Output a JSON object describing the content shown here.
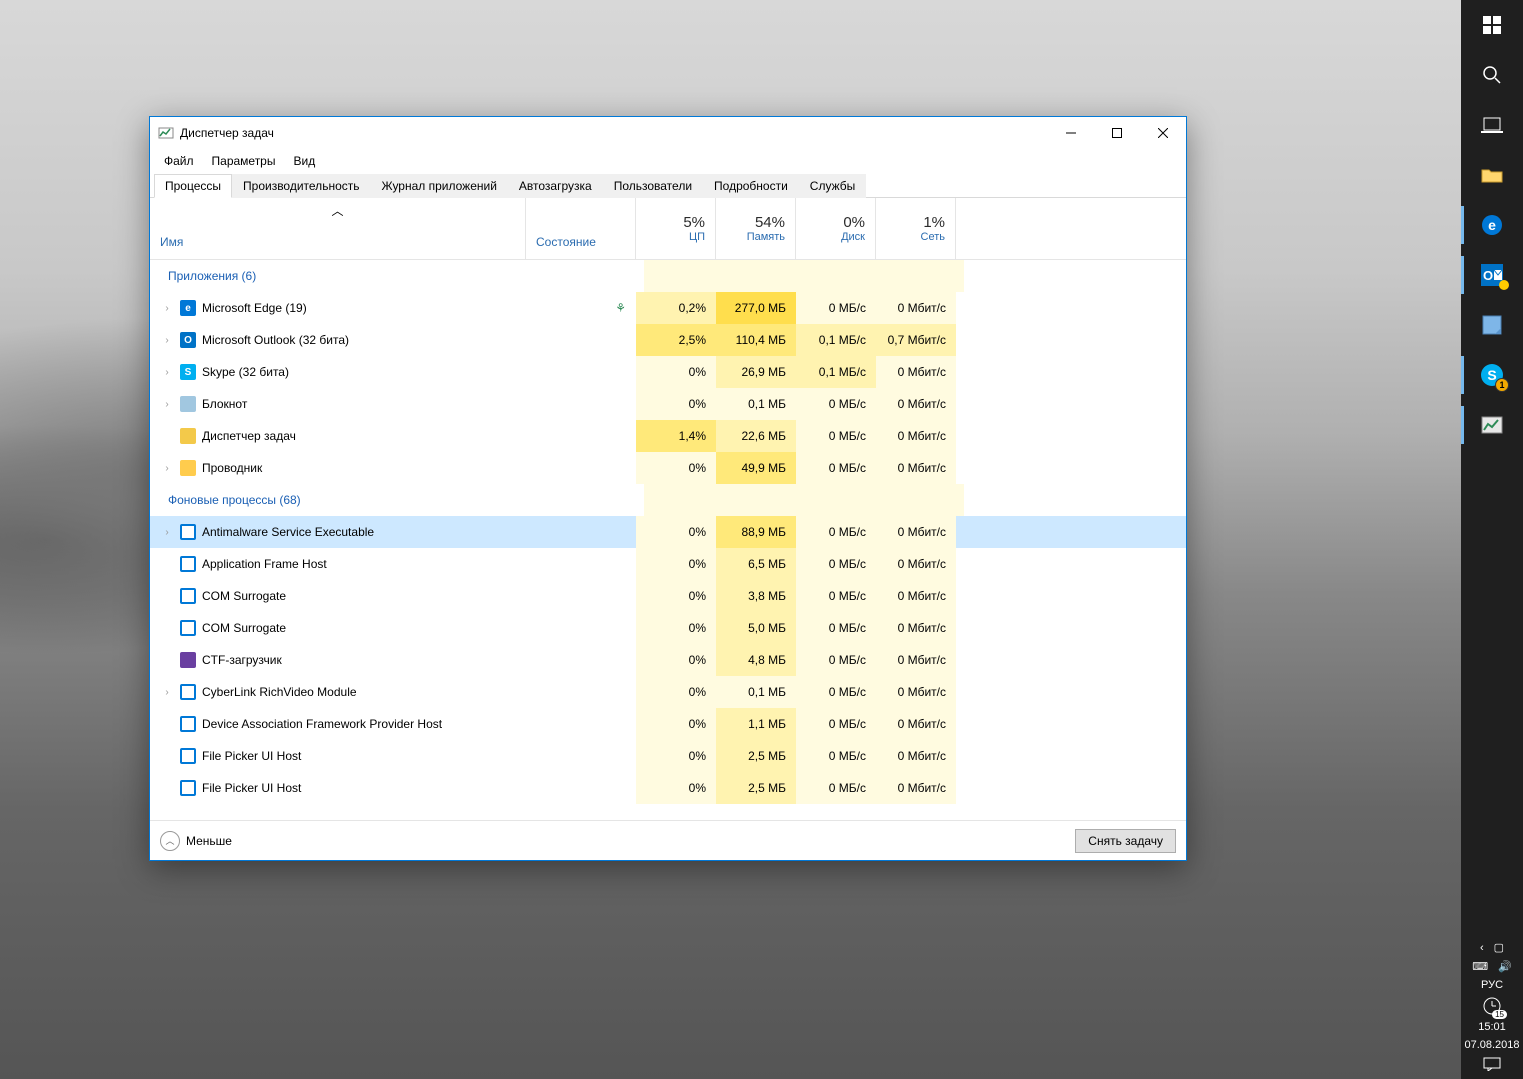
{
  "window": {
    "title": "Диспетчер задач",
    "menu": [
      "Файл",
      "Параметры",
      "Вид"
    ],
    "tabs": [
      "Процессы",
      "Производительность",
      "Журнал приложений",
      "Автозагрузка",
      "Пользователи",
      "Подробности",
      "Службы"
    ],
    "active_tab": 0
  },
  "columns": {
    "name": "Имя",
    "state": "Состояние",
    "metrics": [
      {
        "pct": "5%",
        "label": "ЦП"
      },
      {
        "pct": "54%",
        "label": "Память"
      },
      {
        "pct": "0%",
        "label": "Диск"
      },
      {
        "pct": "1%",
        "label": "Сеть"
      }
    ]
  },
  "groups": [
    {
      "title": "Приложения (6)",
      "rows": [
        {
          "expand": true,
          "icon": {
            "bg": "#0078d7",
            "txt": "e"
          },
          "name": "Microsoft Edge (19)",
          "leaf": true,
          "cpu": "0,2%",
          "mem": "277,0 МБ",
          "disk": "0 МБ/с",
          "net": "0 Мбит/с",
          "heat": {
            "cpu": 2,
            "mem": 4,
            "disk": 1,
            "net": 1
          }
        },
        {
          "expand": true,
          "icon": {
            "bg": "#0072c6",
            "txt": "O"
          },
          "name": "Microsoft Outlook (32 бита)",
          "cpu": "2,5%",
          "mem": "110,4 МБ",
          "disk": "0,1 МБ/с",
          "net": "0,7 Мбит/с",
          "heat": {
            "cpu": 3,
            "mem": 3,
            "disk": 2,
            "net": 2
          }
        },
        {
          "expand": true,
          "icon": {
            "bg": "#00aff0",
            "txt": "S"
          },
          "name": "Skype (32 бита)",
          "cpu": "0%",
          "mem": "26,9 МБ",
          "disk": "0,1 МБ/с",
          "net": "0 Мбит/с",
          "heat": {
            "cpu": 1,
            "mem": 2,
            "disk": 2,
            "net": 1
          }
        },
        {
          "expand": true,
          "icon": {
            "bg": "#a1c7e0",
            "txt": ""
          },
          "name": "Блокнот",
          "cpu": "0%",
          "mem": "0,1 МБ",
          "disk": "0 МБ/с",
          "net": "0 Мбит/с",
          "heat": {
            "cpu": 1,
            "mem": 1,
            "disk": 1,
            "net": 1
          }
        },
        {
          "expand": false,
          "icon": {
            "bg": "#f3c94a",
            "txt": ""
          },
          "name": "Диспетчер задач",
          "cpu": "1,4%",
          "mem": "22,6 МБ",
          "disk": "0 МБ/с",
          "net": "0 Мбит/с",
          "heat": {
            "cpu": 3,
            "mem": 2,
            "disk": 1,
            "net": 1
          }
        },
        {
          "expand": true,
          "icon": {
            "bg": "#ffcc4d",
            "txt": ""
          },
          "name": "Проводник",
          "cpu": "0%",
          "mem": "49,9 МБ",
          "disk": "0 МБ/с",
          "net": "0 Мбит/с",
          "heat": {
            "cpu": 1,
            "mem": 3,
            "disk": 1,
            "net": 1
          }
        }
      ]
    },
    {
      "title": "Фоновые процессы (68)",
      "rows": [
        {
          "expand": true,
          "selected": true,
          "icon": {
            "bg": "#fff",
            "border": "#0078d7"
          },
          "name": "Antimalware Service Executable",
          "cpu": "0%",
          "mem": "88,9 МБ",
          "disk": "0 МБ/с",
          "net": "0 Мбит/с",
          "heat": {
            "cpu": 1,
            "mem": 3,
            "disk": 1,
            "net": 1
          }
        },
        {
          "icon": {
            "bg": "#fff",
            "border": "#0078d7"
          },
          "name": "Application Frame Host",
          "cpu": "0%",
          "mem": "6,5 МБ",
          "disk": "0 МБ/с",
          "net": "0 Мбит/с",
          "heat": {
            "cpu": 1,
            "mem": 2,
            "disk": 1,
            "net": 1
          }
        },
        {
          "icon": {
            "bg": "#fff",
            "border": "#0078d7"
          },
          "name": "COM Surrogate",
          "cpu": "0%",
          "mem": "3,8 МБ",
          "disk": "0 МБ/с",
          "net": "0 Мбит/с",
          "heat": {
            "cpu": 1,
            "mem": 2,
            "disk": 1,
            "net": 1
          }
        },
        {
          "icon": {
            "bg": "#fff",
            "border": "#0078d7"
          },
          "name": "COM Surrogate",
          "cpu": "0%",
          "mem": "5,0 МБ",
          "disk": "0 МБ/с",
          "net": "0 Мбит/с",
          "heat": {
            "cpu": 1,
            "mem": 2,
            "disk": 1,
            "net": 1
          }
        },
        {
          "icon": {
            "bg": "#6a3fa0",
            "txt": ""
          },
          "name": "CTF-загрузчик",
          "cpu": "0%",
          "mem": "4,8 МБ",
          "disk": "0 МБ/с",
          "net": "0 Мбит/с",
          "heat": {
            "cpu": 1,
            "mem": 2,
            "disk": 1,
            "net": 1
          }
        },
        {
          "expand": true,
          "icon": {
            "bg": "#fff",
            "border": "#0078d7"
          },
          "name": "CyberLink RichVideo Module",
          "cpu": "0%",
          "mem": "0,1 МБ",
          "disk": "0 МБ/с",
          "net": "0 Мбит/с",
          "heat": {
            "cpu": 1,
            "mem": 1,
            "disk": 1,
            "net": 1
          }
        },
        {
          "icon": {
            "bg": "#fff",
            "border": "#0078d7"
          },
          "name": "Device Association Framework Provider Host",
          "cpu": "0%",
          "mem": "1,1 МБ",
          "disk": "0 МБ/с",
          "net": "0 Мбит/с",
          "heat": {
            "cpu": 1,
            "mem": 2,
            "disk": 1,
            "net": 1
          }
        },
        {
          "icon": {
            "bg": "#fff",
            "border": "#0078d7"
          },
          "name": "File Picker UI Host",
          "cpu": "0%",
          "mem": "2,5 МБ",
          "disk": "0 МБ/с",
          "net": "0 Мбит/с",
          "heat": {
            "cpu": 1,
            "mem": 2,
            "disk": 1,
            "net": 1
          }
        },
        {
          "icon": {
            "bg": "#fff",
            "border": "#0078d7"
          },
          "name": "File Picker UI Host",
          "cpu": "0%",
          "mem": "2,5 МБ",
          "disk": "0 МБ/с",
          "net": "0 Мбит/с",
          "heat": {
            "cpu": 1,
            "mem": 2,
            "disk": 1,
            "net": 1
          }
        }
      ]
    }
  ],
  "footer": {
    "toggle": "Меньше",
    "end_task": "Снять задачу"
  },
  "taskbar": {
    "tray": {
      "lang": "РУС",
      "time": "15:01",
      "date": "07.08.2018",
      "badge": "15"
    }
  }
}
